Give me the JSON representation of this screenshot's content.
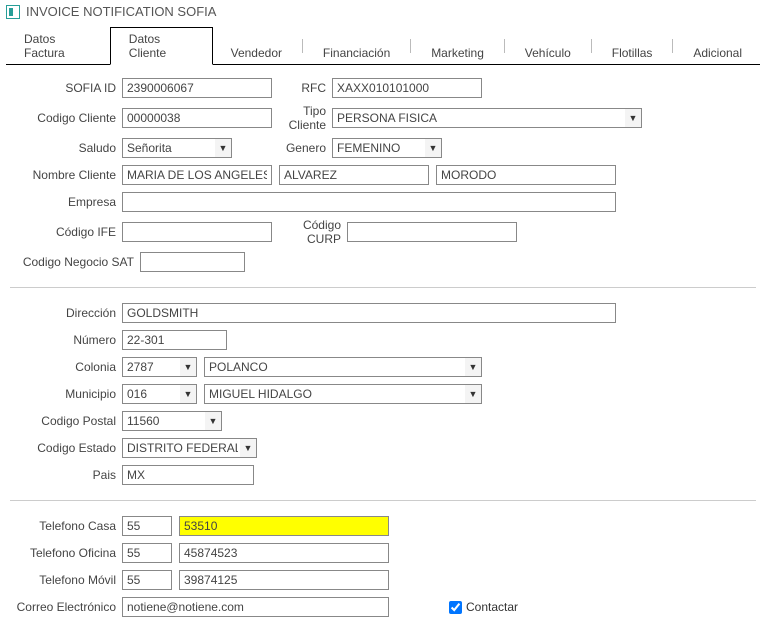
{
  "window": {
    "title": "INVOICE NOTIFICATION SOFIA"
  },
  "tabs": {
    "datos_factura": "Datos Factura",
    "datos_cliente": "Datos Cliente",
    "vendedor": "Vendedor",
    "financiacion": "Financiación",
    "marketing": "Marketing",
    "vehiculo": "Vehículo",
    "flotillas": "Flotillas",
    "adicional": "Adicional"
  },
  "labels": {
    "sofia_id": "SOFIA ID",
    "rfc": "RFC",
    "codigo_cliente": "Codigo Cliente",
    "tipo_cliente": "Tipo Cliente",
    "saludo": "Saludo",
    "genero": "Genero",
    "nombre_cliente": "Nombre Cliente",
    "empresa": "Empresa",
    "codigo_ife": "Código IFE",
    "codigo_curp": "Código CURP",
    "codigo_negocio_sat": "Codigo Negocio SAT",
    "direccion": "Dirección",
    "numero": "Número",
    "colonia": "Colonia",
    "municipio": "Municipio",
    "codigo_postal": "Codigo Postal",
    "codigo_estado": "Codigo Estado",
    "pais": "Pais",
    "telefono_casa": "Telefono Casa",
    "telefono_oficina": "Telefono Oficina",
    "telefono_movil": "Telefono Móvil",
    "correo_electronico": "Correo Electrónico",
    "contactar": "Contactar"
  },
  "values": {
    "sofia_id": "2390006067",
    "rfc": "XAXX010101000",
    "codigo_cliente": "00000038",
    "tipo_cliente": "PERSONA FISICA",
    "saludo": "Señorita",
    "genero": "FEMENINO",
    "nombre1": "MARIA DE LOS ANGELES",
    "nombre2": "ALVAREZ",
    "nombre3": "MORODO",
    "empresa": "",
    "codigo_ife": "",
    "codigo_curp": "",
    "codigo_negocio_sat": "",
    "direccion": "GOLDSMITH",
    "numero": "22-301",
    "colonia_code": "2787",
    "colonia_name": "POLANCO",
    "municipio_code": "016",
    "municipio_name": "MIGUEL HIDALGO",
    "codigo_postal": "11560",
    "codigo_estado": "DISTRITO FEDERAL",
    "pais": "MX",
    "tel_casa_lada": "55",
    "tel_casa_num": "53510",
    "tel_oficina_lada": "55",
    "tel_oficina_num": "45874523",
    "tel_movil_lada": "55",
    "tel_movil_num": "39874125",
    "correo": "notiene@notiene.com",
    "contactar": true
  }
}
